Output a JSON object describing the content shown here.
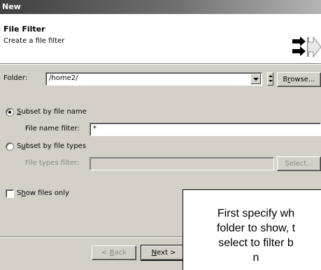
{
  "window": {
    "title": "New"
  },
  "header": {
    "title": "File Filter",
    "description": "Create a file filter",
    "icon": "wizard-arrows-icon"
  },
  "folder": {
    "label_prefix": "Folder: ",
    "value": "/home2/",
    "browse_pre": "B",
    "browse_mnemonic": "r",
    "browse_post": "owse..."
  },
  "subset_name": {
    "label_mnemonic": "S",
    "label_rest": "ubset by file name",
    "selected": true,
    "filter_label": "File name filter:",
    "filter_value": "*"
  },
  "subset_types": {
    "label_pre": "S",
    "label_mnemonic": "u",
    "label_rest": "bset by file types",
    "selected": false,
    "filter_label": "File types filter:",
    "filter_value": "",
    "select_label": "Select..."
  },
  "show_files": {
    "label_pre": "S",
    "label_mnemonic": "h",
    "label_rest": "ow files only",
    "checked": false
  },
  "nav": {
    "back_pre": "< ",
    "back_mnemonic": "B",
    "back_post": "ack",
    "next_mnemonic": "N",
    "next_post": "ext >"
  },
  "callout": {
    "lines": [
      "First specify wh",
      "folder to show, t",
      "select to filter b",
      "n"
    ]
  },
  "colors": {
    "dialog_bg": "#d4d0c8",
    "banner_bg": "#ffffff",
    "titlebar_dark": "#404040",
    "disabled_text": "#8a8880"
  }
}
